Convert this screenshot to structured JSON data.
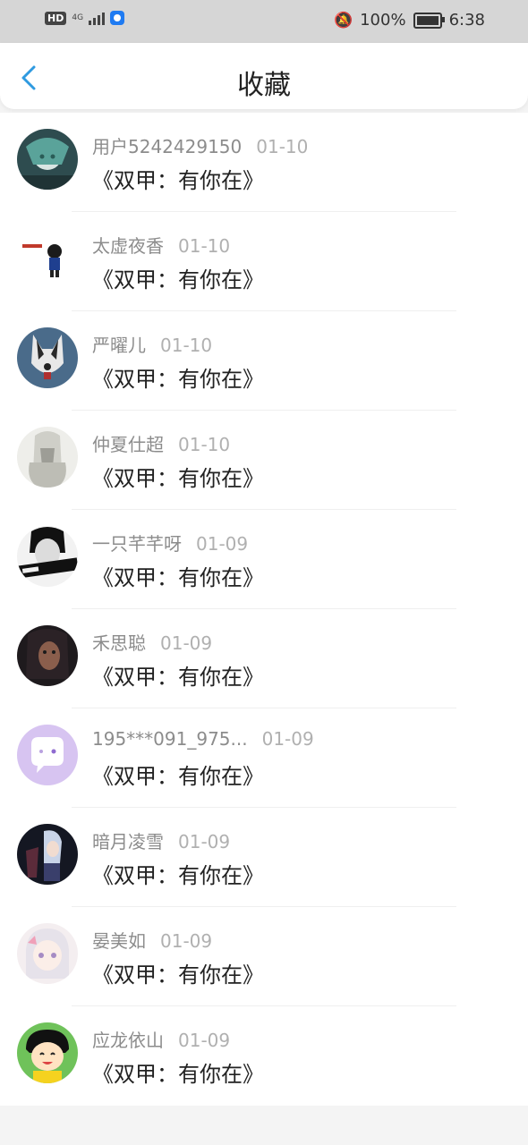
{
  "status": {
    "battery": "100%",
    "time": "6:38",
    "network": "4G",
    "hd": "HD"
  },
  "header": {
    "title": "收藏"
  },
  "items": [
    {
      "name": "用户5242429150",
      "date": "01-10",
      "subject": "《双甲：有你在》"
    },
    {
      "name": "太虚夜香",
      "date": "01-10",
      "subject": "《双甲：有你在》"
    },
    {
      "name": "严曜儿",
      "date": "01-10",
      "subject": "《双甲：有你在》"
    },
    {
      "name": "仲夏仕超",
      "date": "01-10",
      "subject": "《双甲：有你在》"
    },
    {
      "name": "一只芊芊呀",
      "date": "01-09",
      "subject": "《双甲：有你在》"
    },
    {
      "name": "禾思聪",
      "date": "01-09",
      "subject": "《双甲：有你在》"
    },
    {
      "name": "195***091_975...",
      "date": "01-09",
      "subject": "《双甲：有你在》"
    },
    {
      "name": "暗月凌雪",
      "date": "01-09",
      "subject": "《双甲：有你在》"
    },
    {
      "name": "晏美如",
      "date": "01-09",
      "subject": "《双甲：有你在》"
    },
    {
      "name": "应龙依山",
      "date": "01-09",
      "subject": "《双甲：有你在》"
    }
  ]
}
